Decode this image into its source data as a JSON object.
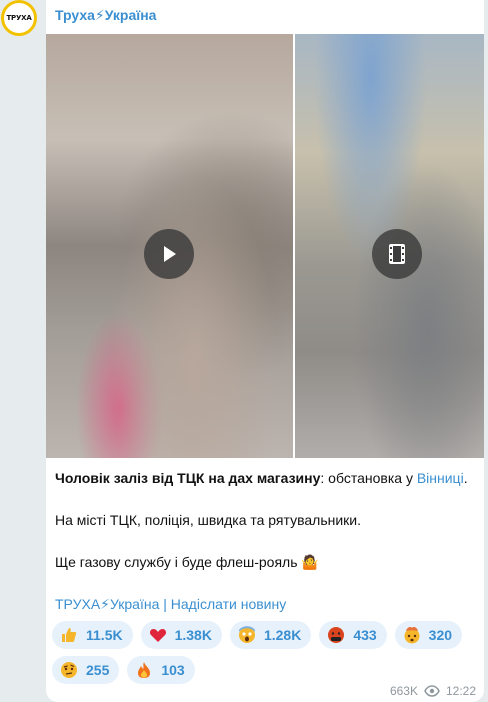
{
  "channel": {
    "avatar_text": "ТРУХА",
    "name": "Труха⚡Україна"
  },
  "media": [
    {
      "type": "video",
      "icon": "play-icon"
    },
    {
      "type": "video",
      "icon": "film-icon"
    }
  ],
  "post": {
    "bold_text": "Чоловік заліз від ТЦК на дах магазину",
    "text_after_bold": ": обстановка у ",
    "link_city": "Вінниці",
    "text_end": ".",
    "paragraph2": "На місті ТЦК, поліція, швидка та рятувальники.",
    "paragraph3": "Ще газову службу і буде флеш-рояль 🤷"
  },
  "footer": {
    "channel_link": "ТРУХА⚡Україна",
    "separator": " | ",
    "submit_link": "Надіслати новину"
  },
  "reactions": [
    {
      "icon": "thumbs-up-icon",
      "count": "11.5K",
      "color": "#f5b62b"
    },
    {
      "icon": "heart-icon",
      "count": "1.38K",
      "color": "#e0263d"
    },
    {
      "icon": "scream-face-icon",
      "count": "1.28K",
      "color": "#f5b62b"
    },
    {
      "icon": "cursing-face-icon",
      "count": "433",
      "color": "#d9431e"
    },
    {
      "icon": "mind-blown-icon",
      "count": "320",
      "color": "#f5b62b"
    },
    {
      "icon": "raised-eyebrow-icon",
      "count": "255",
      "color": "#f5b62b"
    },
    {
      "icon": "fire-icon",
      "count": "103",
      "color": "#f2711c"
    }
  ],
  "meta": {
    "views": "663K",
    "time": "12:22"
  },
  "colors": {
    "accent": "#3a8fd0",
    "reaction_bg": "#e7f1fb",
    "avatar_ring": "#f2c200"
  }
}
